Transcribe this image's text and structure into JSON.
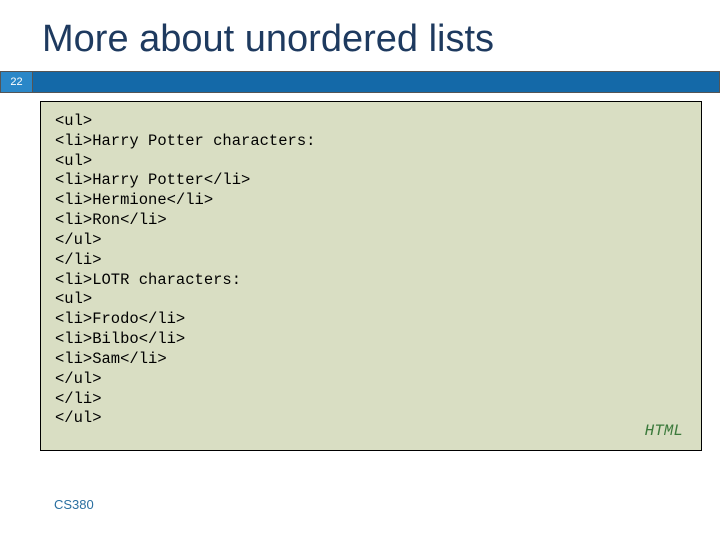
{
  "title": "More about unordered lists",
  "page_number": "22",
  "footer": "CS380",
  "code": {
    "language_label": "HTML",
    "lines": [
      "<ul>",
      "<li>Harry Potter characters:",
      "<ul>",
      "<li>Harry Potter</li>",
      "<li>Hermione</li>",
      "<li>Ron</li>",
      "</ul>",
      "</li>",
      "<li>LOTR characters:",
      "<ul>",
      "<li>Frodo</li>",
      "<li>Bilbo</li>",
      "<li>Sam</li>",
      "</ul>",
      "</li>",
      "</ul>"
    ]
  }
}
